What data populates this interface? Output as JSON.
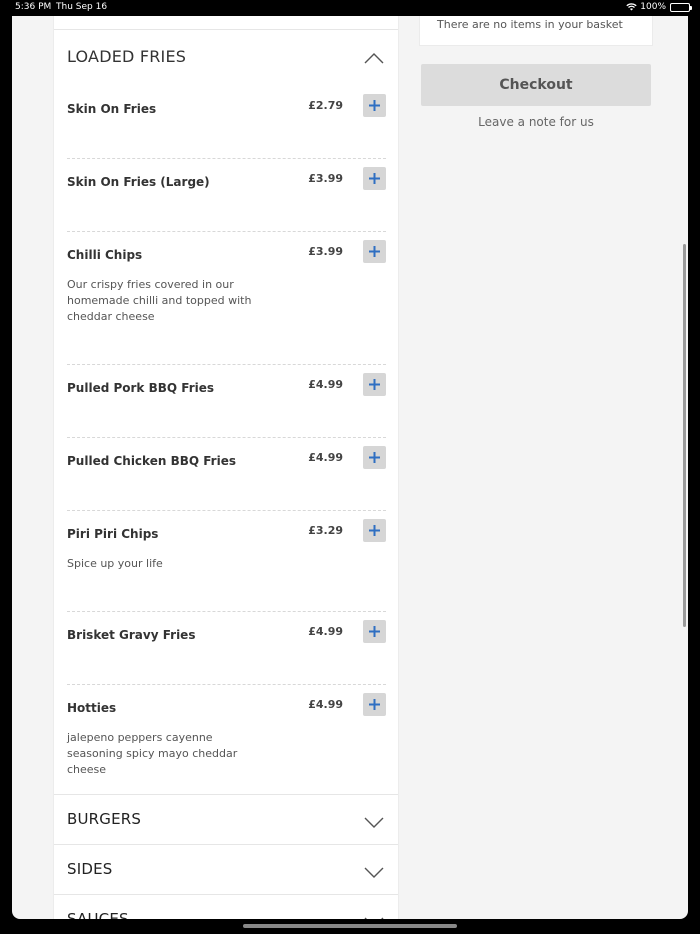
{
  "status": {
    "time": "5:36 PM",
    "date": "Thu Sep 16",
    "battery": "100%"
  },
  "basket": {
    "empty_text": "There are no items in your basket",
    "checkout_label": "Checkout",
    "note_label": "Leave a note for us"
  },
  "menu": {
    "open_section": "LOADED FRIES",
    "items": [
      {
        "name": "Skin On Fries",
        "price": "£2.79",
        "desc": ""
      },
      {
        "name": "Skin On Fries (Large)",
        "price": "£3.99",
        "desc": ""
      },
      {
        "name": "Chilli Chips",
        "price": "£3.99",
        "desc": "Our crispy fries covered in our homemade chilli and topped with cheddar cheese"
      },
      {
        "name": "Pulled Pork BBQ Fries",
        "price": "£4.99",
        "desc": ""
      },
      {
        "name": "Pulled Chicken BBQ Fries",
        "price": "£4.99",
        "desc": ""
      },
      {
        "name": "Piri Piri Chips",
        "price": "£3.29",
        "desc": "Spice up your life"
      },
      {
        "name": "Brisket Gravy Fries",
        "price": "£4.99",
        "desc": ""
      },
      {
        "name": "Hotties",
        "price": "£4.99",
        "desc": "jalepeno peppers cayenne seasoning spicy mayo cheddar cheese"
      }
    ],
    "categories": [
      "BURGERS",
      "SIDES",
      "SAUCES"
    ]
  },
  "colors": {
    "accent": "#2f6fc2",
    "button_bg": "#d6d6d6",
    "panel_bg": "#f4f4f4"
  }
}
